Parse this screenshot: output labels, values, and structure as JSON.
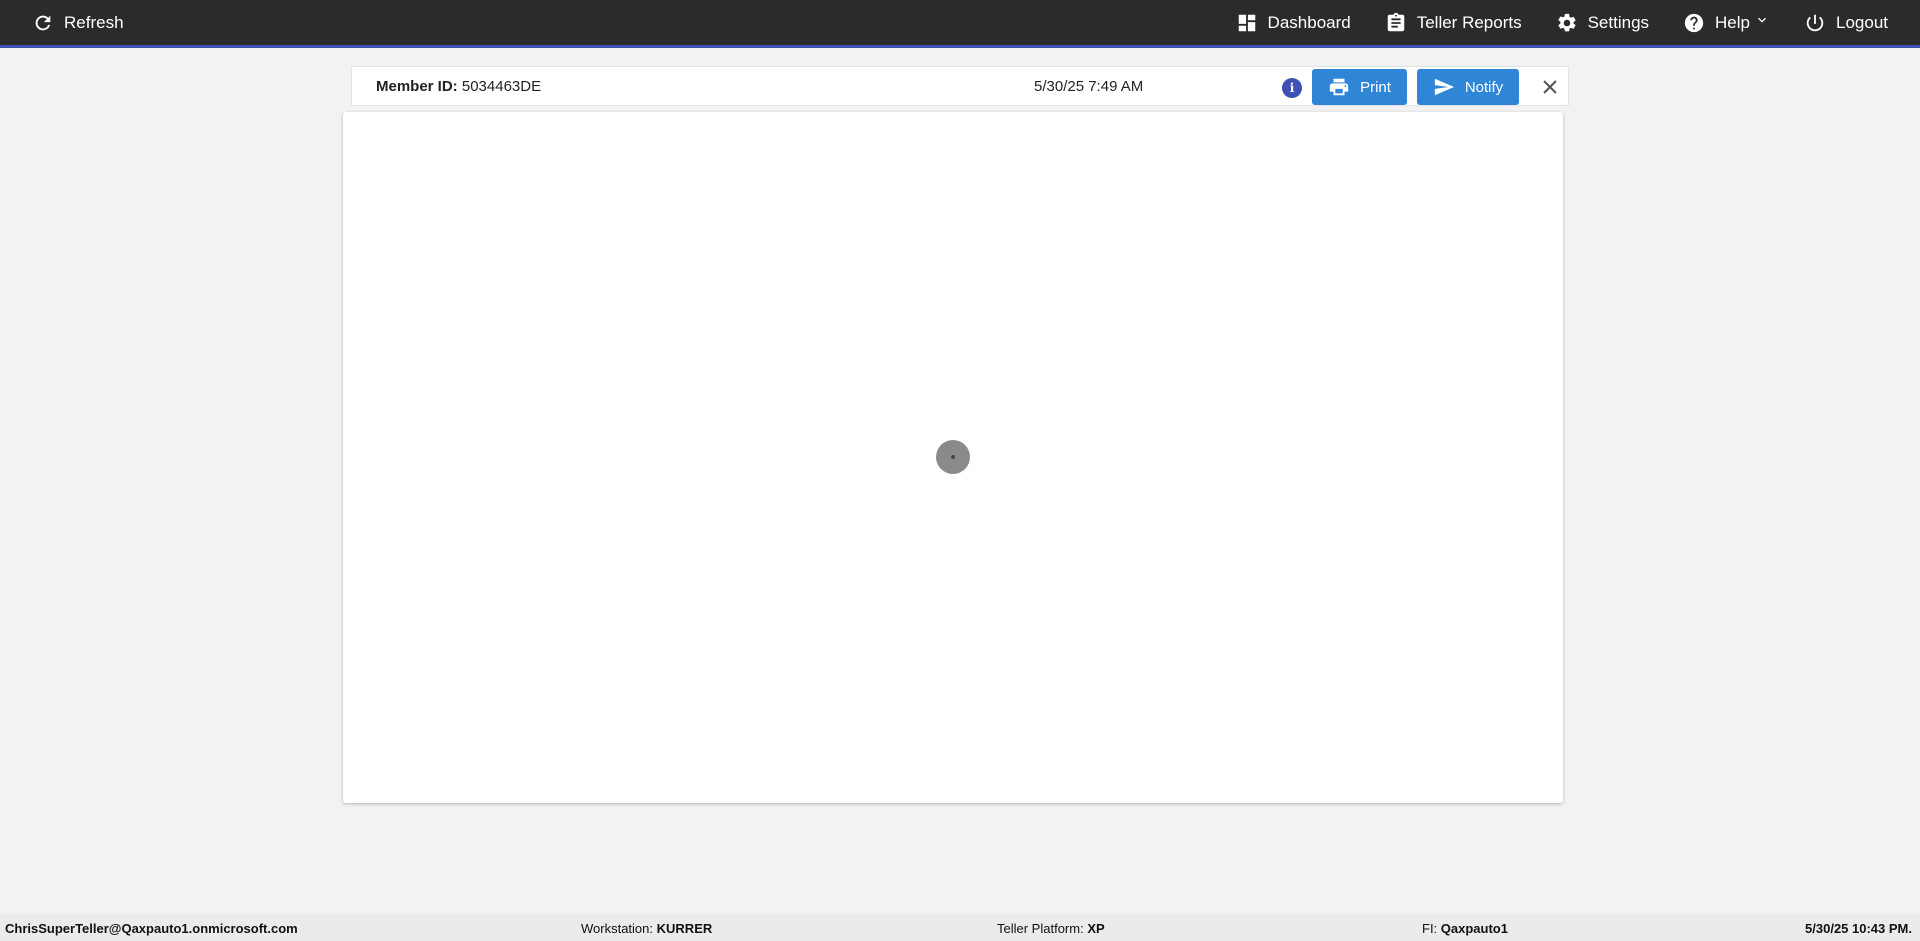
{
  "topbar": {
    "refresh_label": "Refresh",
    "nav": {
      "dashboard": "Dashboard",
      "teller_reports": "Teller Reports",
      "settings": "Settings",
      "help": "Help",
      "logout": "Logout"
    }
  },
  "member": {
    "id_label": "Member ID:",
    "id_value": "5034463DE",
    "datetime": "5/30/25 7:49 AM",
    "print_label": "Print",
    "notify_label": "Notify"
  },
  "footer": {
    "user": "ChrisSuperTeller@Qaxpauto1.onmicrosoft.com",
    "workstation_label": "Workstation:",
    "workstation_value": "KURRER",
    "platform_label": "Teller Platform:",
    "platform_value": "XP",
    "fi_label": "FI:",
    "fi_value": "Qaxpauto1",
    "timestamp": "5/30/25 10:43 PM."
  },
  "colors": {
    "topbar_bg": "#2b2b2b",
    "accent_blue": "#2f86d6",
    "indigo": "#3f51b5"
  }
}
